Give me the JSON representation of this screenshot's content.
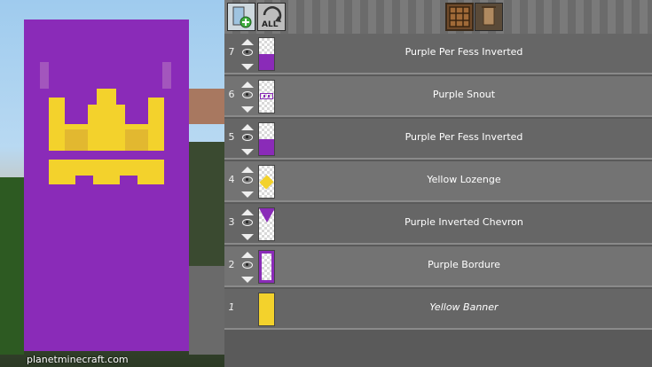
{
  "watermark": "planetminecraft.com",
  "toolbar": {
    "add_icon": "add-layer-icon",
    "all_icon": "all-icon",
    "all_label": "ALL",
    "craft_icon": "crafting-table-icon",
    "banner_icon": "banner-icon"
  },
  "layers": [
    {
      "num": "7",
      "label": "Purple Per Fess Inverted",
      "thumb": "per-fess-inverted"
    },
    {
      "num": "6",
      "label": "Purple Snout",
      "thumb": "snout"
    },
    {
      "num": "5",
      "label": "Purple Per Fess Inverted",
      "thumb": "per-fess-inverted"
    },
    {
      "num": "4",
      "label": "Yellow Lozenge",
      "thumb": "lozenge"
    },
    {
      "num": "3",
      "label": "Purple Inverted Chevron",
      "thumb": "inverted-chevron"
    },
    {
      "num": "2",
      "label": "Purple Bordure",
      "thumb": "bordure"
    },
    {
      "num": "1",
      "label": "Yellow Banner",
      "thumb": "base"
    }
  ],
  "colors": {
    "purple": "#8a2bb8",
    "yellow": "#f3d22c"
  }
}
